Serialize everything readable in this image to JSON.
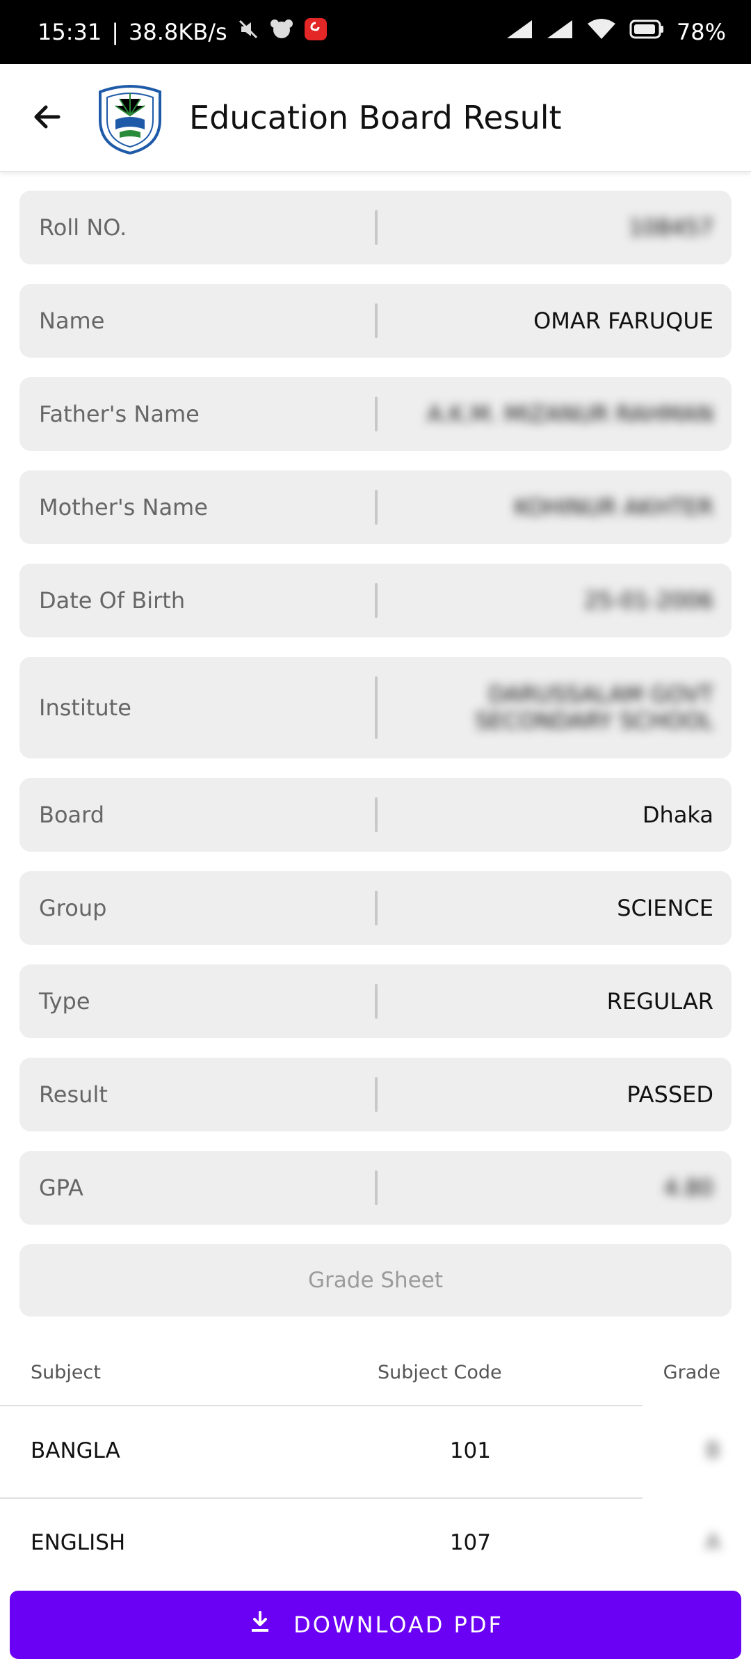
{
  "status_bar": {
    "time": "15:31",
    "speed": "38.8KB/s",
    "battery": "78%"
  },
  "app_bar": {
    "title": "Education Board Result"
  },
  "fields": [
    {
      "label": "Roll NO.",
      "value": "108457"
    },
    {
      "label": "Name",
      "value": "OMAR FARUQUE"
    },
    {
      "label": "Father's Name",
      "value": "A.K.M. MIZANUR RAHMAN"
    },
    {
      "label": "Mother's Name",
      "value": "KOHINUR AKHTER"
    },
    {
      "label": "Date Of Birth",
      "value": "25-01-2006"
    },
    {
      "label": "Institute",
      "value": "DARUSSALAM GOVT SECONDARY SCHOOL"
    },
    {
      "label": "Board",
      "value": "Dhaka"
    },
    {
      "label": "Group",
      "value": "SCIENCE"
    },
    {
      "label": "Type",
      "value": "REGULAR"
    },
    {
      "label": "Result",
      "value": "PASSED"
    },
    {
      "label": "GPA",
      "value": "4.80"
    }
  ],
  "grade_sheet": {
    "title": "Grade Sheet",
    "columns": {
      "subject": "Subject",
      "code": "Subject Code",
      "grade": "Grade"
    },
    "rows": [
      {
        "subject": "BANGLA",
        "code": "101",
        "grade": "B"
      },
      {
        "subject": "ENGLISH",
        "code": "107",
        "grade": "A"
      }
    ]
  },
  "download_button": {
    "label": "DOWNLOAD PDF"
  },
  "colors": {
    "accent": "#6a00f4",
    "passed": "#0a8a0a",
    "field_bg": "#eeeeee"
  }
}
